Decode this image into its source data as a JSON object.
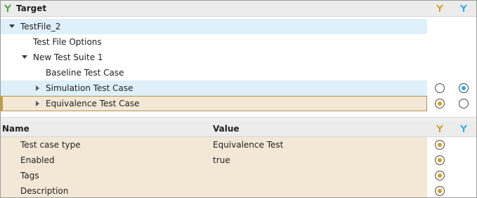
{
  "tree_header": {
    "title": "Target"
  },
  "tree": {
    "rows": [
      {
        "label": "TestFile_2"
      },
      {
        "label": "Test File Options"
      },
      {
        "label": "New Test Suite 1"
      },
      {
        "label": "Baseline Test Case"
      },
      {
        "label": "Simulation Test Case"
      },
      {
        "label": "Equivalence Test Case"
      }
    ]
  },
  "props_header": {
    "name_col": "Name",
    "value_col": "Value"
  },
  "props": {
    "rows": [
      {
        "name": "Test case type",
        "value": "Equivalence Test"
      },
      {
        "name": "Enabled",
        "value": "true"
      },
      {
        "name": "Tags",
        "value": ""
      },
      {
        "name": "Description",
        "value": ""
      }
    ]
  },
  "colors": {
    "gold": "#c99e2f",
    "blue": "#2aa9e8",
    "selection_blue": "#dff0fa",
    "selection_tan": "#f3e8d6"
  },
  "icons": {
    "target": "branch-merge-icon",
    "left_branch": "gold-branch-icon",
    "right_branch": "blue-branch-icon"
  }
}
